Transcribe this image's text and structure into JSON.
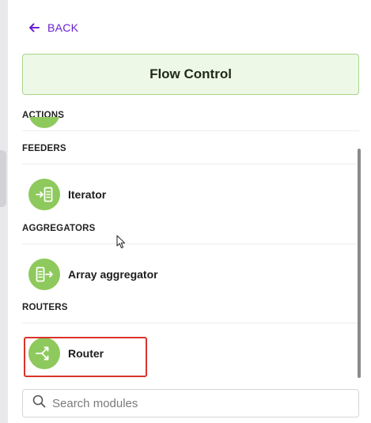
{
  "nav": {
    "back_label": "BACK"
  },
  "panel": {
    "title": "Flow Control"
  },
  "sections": {
    "actions": "ACTIONS",
    "feeders": "FEEDERS",
    "aggregators": "AGGREGATORS",
    "routers": "ROUTERS"
  },
  "modules": {
    "iterator": {
      "label": "Iterator",
      "icon": "iterator-icon"
    },
    "array_aggregator": {
      "label": "Array aggregator",
      "icon": "array-aggregator-icon"
    },
    "router": {
      "label": "Router",
      "icon": "router-icon"
    }
  },
  "search": {
    "placeholder": "Search modules",
    "value": ""
  },
  "colors": {
    "accent": "#6a1fd0",
    "module_green": "#8dc95c",
    "header_bg": "#eef8e6",
    "header_border": "#a8d58a",
    "highlight_red": "#d9342b"
  }
}
